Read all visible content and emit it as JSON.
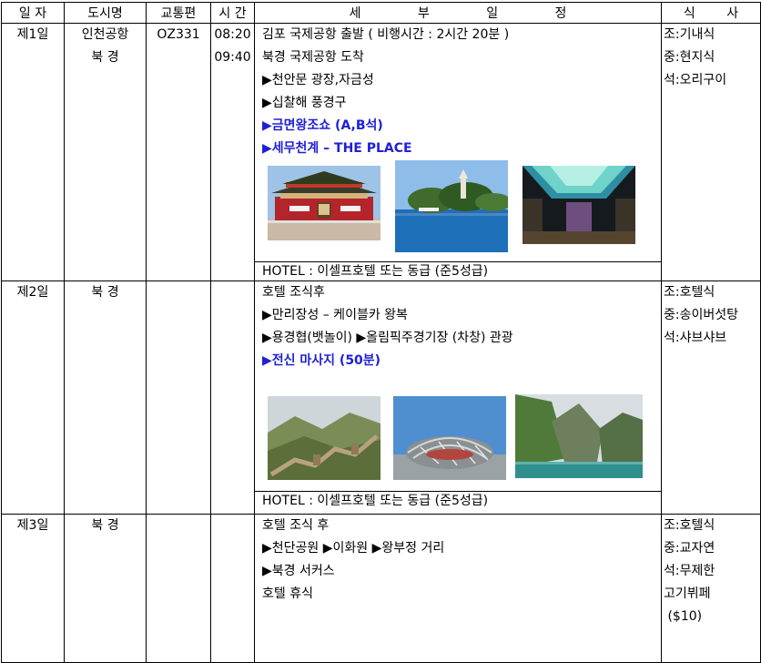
{
  "headers": {
    "day": "일 자",
    "city": "도시명",
    "transport": "교통편",
    "time": "시 간",
    "detail": "세 부 일 정",
    "meal": "식 사"
  },
  "days": [
    {
      "day": "제1일",
      "cities": [
        "인천공항",
        "북 경"
      ],
      "transport": "OZ331",
      "times": [
        "08:20",
        "09:40"
      ],
      "schedule": [
        {
          "text": "김포 국제공항 출발 ( 비행시간 : 2시간 20분 )",
          "style": "plain"
        },
        {
          "text": "북경 국제공항 도착",
          "style": "plain"
        },
        {
          "text": "▶천안문 광장,자금성",
          "style": "plain"
        },
        {
          "text": "▶십찰해 풍경구",
          "style": "plain"
        },
        {
          "text": "▶금면왕조쇼 (A,B석)",
          "style": "blue"
        },
        {
          "text": "▶세무천계 – THE PLACE",
          "style": "blue"
        }
      ],
      "photos": [
        "tiananmen-gate",
        "beihai-lake",
        "the-place-led-canopy"
      ],
      "hotel": "HOTEL : 이셀프호텔 또는 동급 (준5성급)",
      "meals": [
        "조:기내식",
        "중:현지식",
        "석:오리구이"
      ]
    },
    {
      "day": "제2일",
      "cities": [
        "북 경"
      ],
      "transport": "",
      "times": [],
      "schedule": [
        {
          "text": "호텔 조식후",
          "style": "plain"
        },
        {
          "text": "▶만리장성 – 케이블카 왕복",
          "style": "plain"
        },
        {
          "text": "▶용경협(뱃놀이) ▶올림픽주경기장 (차창) 관광",
          "style": "plain"
        },
        {
          "text": "▶전신 마사지 (50분)",
          "style": "blue"
        }
      ],
      "photos": [
        "great-wall",
        "birds-nest-stadium",
        "longqing-gorge"
      ],
      "hotel": "HOTEL : 이셀프호텔 또는 동급 (준5성급)",
      "meals": [
        "조:호텔식",
        "중:송이버섯탕",
        "석:샤브샤브"
      ]
    },
    {
      "day": "제3일",
      "cities": [
        "북 경"
      ],
      "transport": "",
      "times": [],
      "schedule": [
        {
          "text": "호텔 조식 후",
          "style": "plain"
        },
        {
          "text": "▶천단공원 ▶이화원 ▶왕부정 거리",
          "style": "plain"
        },
        {
          "text": "▶북경 서커스",
          "style": "plain"
        },
        {
          "text": "호텔 휴식",
          "style": "plain"
        }
      ],
      "photos": [],
      "hotel": "",
      "meals": [
        "조:호텔식",
        "중:교자연",
        "석:무제한",
        "고기뷔페",
        " ($10)"
      ]
    }
  ]
}
